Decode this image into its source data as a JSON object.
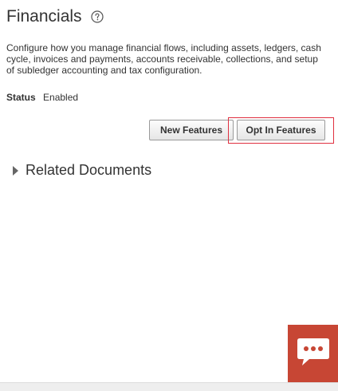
{
  "page": {
    "title": "Financials",
    "description": "Configure how you manage financial flows, including assets, ledgers, cash cycle, invoices and payments, accounts receivable, collections, and setup of subledger accounting and tax configuration.",
    "status_label": "Status",
    "status_value": "Enabled"
  },
  "buttons": {
    "new_features": "New Features",
    "opt_in_features": "Opt In Features"
  },
  "related": {
    "label": "Related Documents"
  },
  "icons": {
    "help": "help-question-icon",
    "expand": "triangle-right-icon",
    "chat": "chat-bubble-icon"
  },
  "colors": {
    "highlight": "#e03040",
    "chat_bg": "#c74634"
  }
}
